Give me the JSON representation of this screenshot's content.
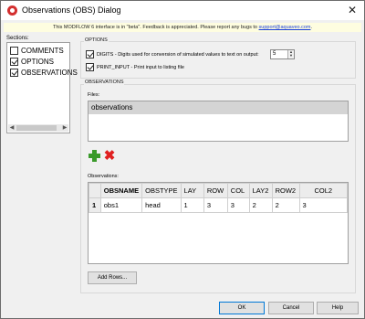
{
  "window": {
    "title": "Observations (OBS) Dialog",
    "close_glyph": "✕"
  },
  "banner": {
    "text": "This MODFLOW 6 interface is in \"beta\". Feedback is appreciated. Please report any bugs to ",
    "link": "support@aquaveo.com",
    "suffix": "."
  },
  "sections": {
    "label": "Sections:",
    "items": [
      {
        "label": "COMMENTS",
        "checked": false
      },
      {
        "label": "OPTIONS",
        "checked": true
      },
      {
        "label": "OBSERVATIONS",
        "checked": true
      }
    ]
  },
  "options": {
    "label": "OPTIONS",
    "digits": {
      "label": "DIGITS - Digits used for conversion of simulated values to text on output:",
      "checked": true,
      "value": "5"
    },
    "print_input": {
      "label": "PRINT_INPUT - Print input to listing file",
      "checked": true
    }
  },
  "observations": {
    "label": "OBSERVATIONS",
    "files_label": "Files:",
    "files": [
      "observations"
    ],
    "table_label": "Observations:",
    "columns": [
      "OBSNAME",
      "OBSTYPE",
      "LAY",
      "ROW",
      "COL",
      "LAY2",
      "ROW2",
      "COL2"
    ],
    "rows": [
      {
        "num": "1",
        "cells": [
          "obs1",
          "head",
          "1",
          "3",
          "3",
          "2",
          "2",
          "3"
        ]
      }
    ],
    "add_rows_label": "Add Rows..."
  },
  "icons": {
    "add": "add-icon",
    "delete": "delete-icon"
  },
  "footer": {
    "ok": "OK",
    "cancel": "Cancel",
    "help": "Help"
  },
  "colors": {
    "accent": "#0078d7",
    "banner_bg": "#fefde0",
    "add_green": "#3a9a2a",
    "delete_red": "#e02020",
    "link_blue": "#1a3fd8"
  }
}
